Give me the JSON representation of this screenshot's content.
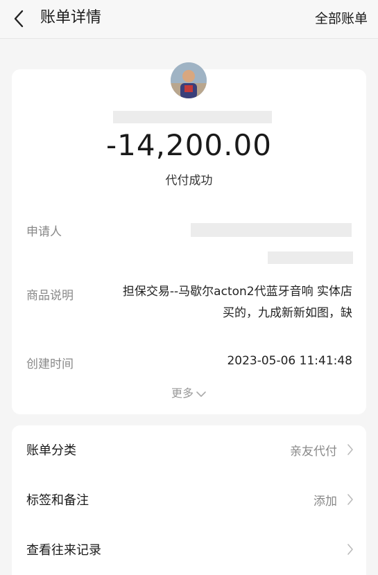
{
  "header": {
    "title": "账单详情",
    "right_link": "全部账单"
  },
  "summary": {
    "amount": "-14,200.00",
    "status": "代付成功"
  },
  "details": {
    "applicant_label": "申请人",
    "description_label": "商品说明",
    "description_line1": "担保交易--马歇尔acton2代蓝牙音响 实体店",
    "description_line2": "买的，九成新新如图，缺",
    "created_label": "创建时间",
    "created_value": "2023-05-06 11:41:48",
    "more_label": "更多"
  },
  "list": [
    {
      "label": "账单分类",
      "value": "亲友代付"
    },
    {
      "label": "标签和备注",
      "value": "添加"
    },
    {
      "label": "查看往来记录",
      "value": ""
    }
  ],
  "icons": {
    "back": "chevron-left-icon",
    "more": "chevron-down-icon",
    "row": "chevron-right-icon"
  },
  "colors": {
    "background": "#f5f5f5",
    "card": "#ffffff",
    "muted_text": "#888888",
    "redaction": "#ececec"
  }
}
